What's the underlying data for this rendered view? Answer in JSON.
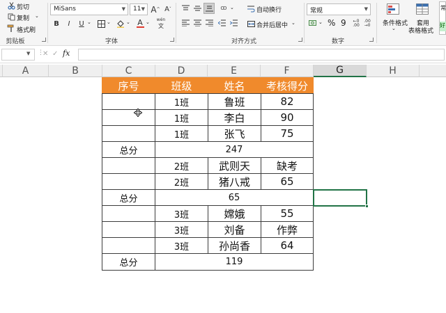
{
  "ribbon": {
    "clipboard": {
      "cut_label": "剪切",
      "copy_label": "复制",
      "format_painter_label": "格式刷",
      "group_label": "剪贴板"
    },
    "font": {
      "font_name": "MiSans",
      "font_size": "11",
      "grow_label": "A",
      "shrink_label": "A",
      "bold": "B",
      "italic": "I",
      "underline": "U",
      "font_color_letter": "A",
      "phonetic_label": "wén",
      "group_label": "字体"
    },
    "alignment": {
      "wrap_text_label": "自动换行",
      "merge_center_label": "合并后居中",
      "group_label": "对齐方式"
    },
    "number": {
      "format_value": "常规",
      "percent_label": "%",
      "comma_label": "9",
      "group_label": "数字"
    },
    "styles": {
      "conditional_format_label": "条件格式",
      "table_format_label_1": "套用",
      "table_format_label_2": "表格格式",
      "cell_style_partial": "常",
      "cell_style_partial_2": "好"
    }
  },
  "formula_bar": {
    "name_box_value": "",
    "fx_label": "fx",
    "formula_value": ""
  },
  "columns": [
    "A",
    "B",
    "C",
    "D",
    "E",
    "F",
    "G",
    "H"
  ],
  "active_column": "G",
  "table": {
    "headers": [
      "序号",
      "班级",
      "姓名",
      "考核得分"
    ],
    "rows": [
      {
        "seq": "",
        "cls": "1班",
        "name": "鲁班",
        "score": "82"
      },
      {
        "seq": "",
        "cls": "1班",
        "name": "李白",
        "score": "90"
      },
      {
        "seq": "",
        "cls": "1班",
        "name": "张飞",
        "score": "75"
      },
      {
        "total_label": "总分",
        "total": "247"
      },
      {
        "seq": "",
        "cls": "2班",
        "name": "武则天",
        "score": "缺考"
      },
      {
        "seq": "",
        "cls": "2班",
        "name": "猪八戒",
        "score": "65"
      },
      {
        "total_label": "总分",
        "total": "65"
      },
      {
        "seq": "",
        "cls": "3班",
        "name": "嫦娥",
        "score": "55"
      },
      {
        "seq": "",
        "cls": "3班",
        "name": "刘备",
        "score": "作弊"
      },
      {
        "seq": "",
        "cls": "3班",
        "name": "孙尚香",
        "score": "64"
      },
      {
        "total_label": "总分",
        "total": "119"
      }
    ]
  },
  "colors": {
    "header_bg": "#f08a2c",
    "selection": "#217346"
  }
}
